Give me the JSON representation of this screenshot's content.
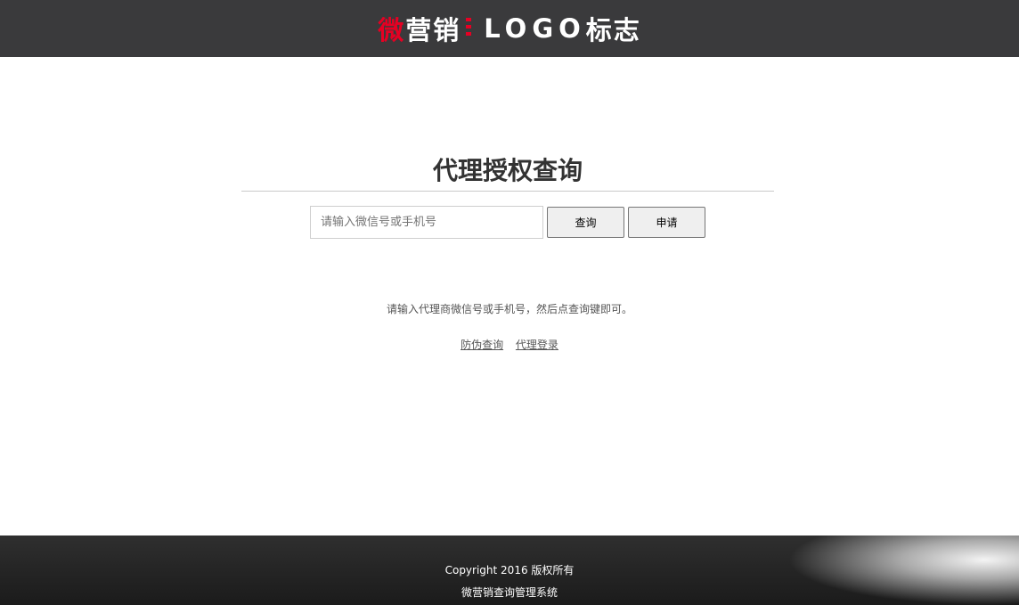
{
  "header": {
    "logo": {
      "wei": "微",
      "yingxiao": "营销",
      "latin": "LOGO",
      "biaozhi": "标志"
    }
  },
  "main": {
    "title": "代理授权查询",
    "search": {
      "placeholder": "请输入微信号或手机号",
      "value": ""
    },
    "buttons": {
      "query": "查询",
      "apply": "申请"
    },
    "hint": "请输入代理商微信号或手机号，然后点查询键即可。",
    "links": {
      "anti_fake": "防伪查询",
      "agent_login": "代理登录"
    }
  },
  "footer": {
    "copyright": "Copyright 2016 版权所有",
    "system_name": "微营销查询管理系统"
  },
  "colors": {
    "header_bg": "#3a3a3c",
    "accent_red": "#e60023",
    "footer_bg": "#1f1f1f"
  }
}
